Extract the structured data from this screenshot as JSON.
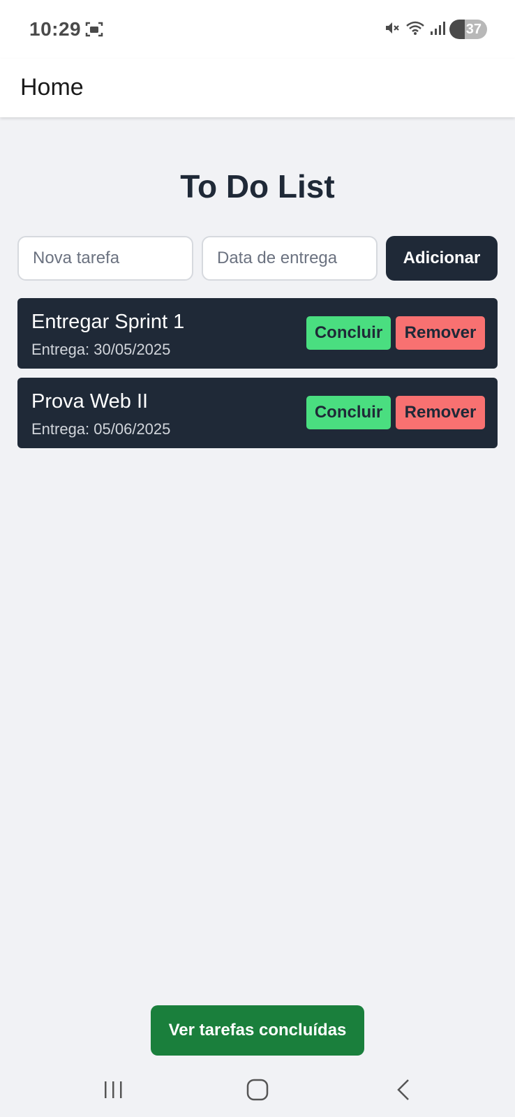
{
  "status_bar": {
    "time": "10:29",
    "battery_level": "37",
    "icons": [
      "screenshot-icon",
      "mute-icon",
      "wifi-icon",
      "signal-icon",
      "battery-icon"
    ]
  },
  "app_bar": {
    "title": "Home"
  },
  "main": {
    "heading": "To Do List",
    "task_input": {
      "placeholder": "Nova tarefa",
      "value": ""
    },
    "date_input": {
      "placeholder": "Data de entrega",
      "value": ""
    },
    "add_label": "Adicionar"
  },
  "tasks": [
    {
      "title": "Entregar Sprint 1",
      "due": "Entrega: 30/05/2025",
      "complete_label": "Concluir",
      "remove_label": "Remover"
    },
    {
      "title": "Prova Web II",
      "due": "Entrega: 05/06/2025",
      "complete_label": "Concluir",
      "remove_label": "Remover"
    }
  ],
  "footer": {
    "completed_label": "Ver tarefas concluídas"
  },
  "colors": {
    "dark": "#1f2937",
    "complete": "#4ade80",
    "remove": "#f87171",
    "completed_button": "#1a7f3c",
    "background": "#f1f2f5"
  }
}
